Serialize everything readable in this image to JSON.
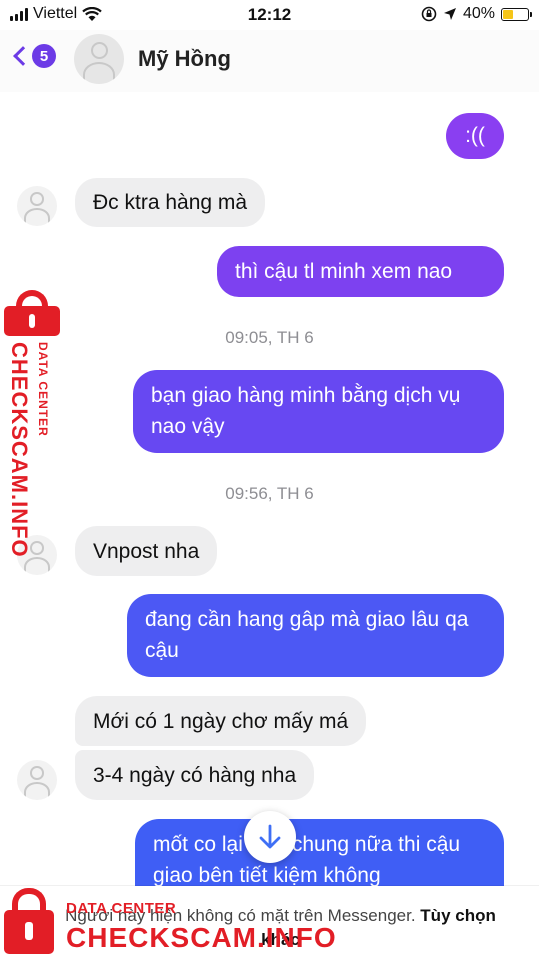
{
  "status_bar": {
    "carrier": "Viettel",
    "time": "12:12",
    "battery_percent": "40%",
    "battery_level": 0.4
  },
  "header": {
    "back_badge": "5",
    "contact_name": "Mỹ Hồng"
  },
  "colors": {
    "accent": "#6c3be6",
    "bubble_out_start": "#7a3ff0",
    "bubble_out_end": "#3f5ef5",
    "bubble_in": "#eeeeef",
    "watermark": "#e21e26"
  },
  "messages": [
    {
      "sender": "me",
      "text": ":(("
    },
    {
      "sender": "them",
      "text": "Đc ktra hàng mà"
    },
    {
      "sender": "me",
      "text": "thì cậu tl minh xem nao"
    },
    {
      "sender": "timestamp",
      "text": "09:05, TH 6"
    },
    {
      "sender": "me",
      "text": "bạn giao hàng minh bằng dịch vụ nao vậy"
    },
    {
      "sender": "timestamp",
      "text": "09:56, TH 6"
    },
    {
      "sender": "them",
      "text": "Vnpost nha"
    },
    {
      "sender": "me",
      "text": "đang cần hang gâp mà giao lâu qa cậu"
    },
    {
      "sender": "them",
      "text": "Mới có 1 ngày chơ mấy má"
    },
    {
      "sender": "them",
      "text": "3-4 ngày có hàng nha"
    },
    {
      "sender": "me",
      "text": "mốt co lại việc chung nữa thi cậu giao bên tiết kiệm không"
    }
  ],
  "footer": {
    "notice": "Người này hiện không có mặt trên Messenger.",
    "options_link": "Tùy chọn khác"
  },
  "watermark": {
    "label": "DATA CENTER",
    "brand": "CHECKSCAM.INFO"
  },
  "icons": {
    "back": "chevron-left-icon",
    "scroll": "arrow-down-icon",
    "location": "location-arrow-icon",
    "orientation_lock": "orientation-lock-icon",
    "wifi": "wifi-icon"
  }
}
